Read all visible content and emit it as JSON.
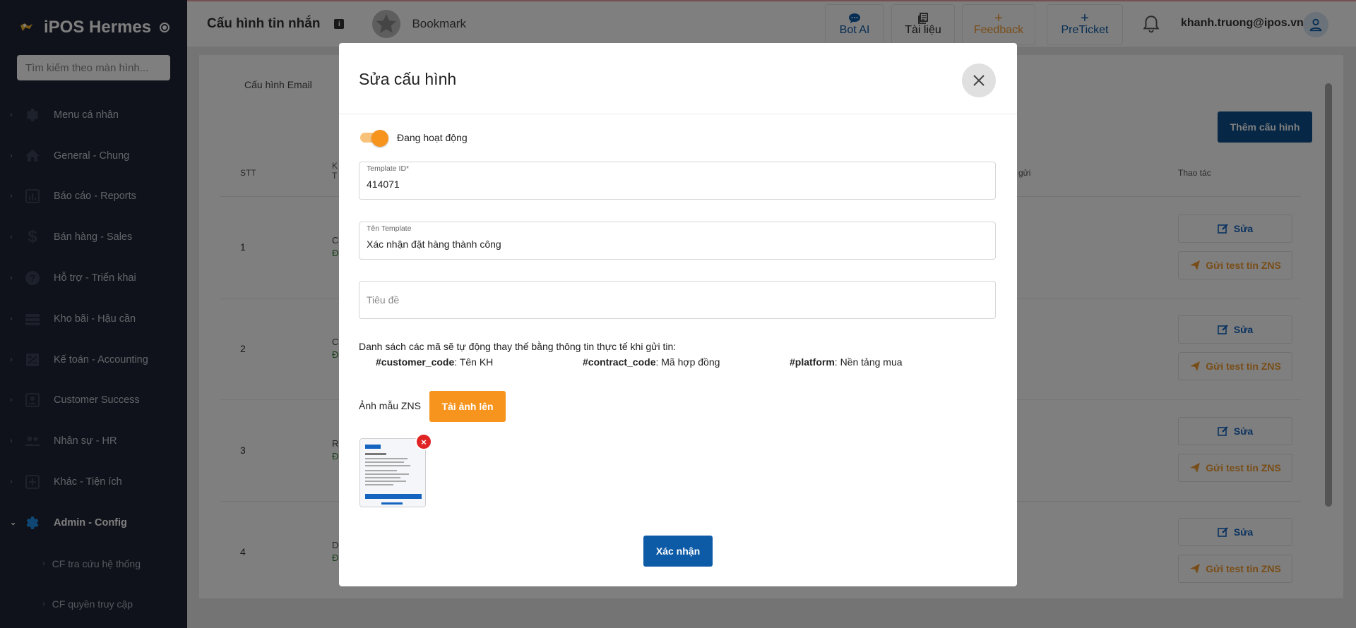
{
  "sidebar": {
    "brand": "iPOS Hermes",
    "search_placeholder": "Tìm kiếm theo màn hình...",
    "items": [
      {
        "label": "Menu cá nhân",
        "icon": "gear-icon"
      },
      {
        "label": "General - Chung",
        "icon": "home-icon"
      },
      {
        "label": "Báo cáo - Reports",
        "icon": "bar-chart-icon"
      },
      {
        "label": "Bán hàng - Sales",
        "icon": "dollar-icon"
      },
      {
        "label": "Hỗ trợ - Triển khai",
        "icon": "help-icon"
      },
      {
        "label": "Kho bãi - Hậu cần",
        "icon": "warehouse-icon"
      },
      {
        "label": "Kế toán - Accounting",
        "icon": "accounting-icon"
      },
      {
        "label": "Customer Success",
        "icon": "contact-card-icon"
      },
      {
        "label": "Nhân sự - HR",
        "icon": "people-icon"
      },
      {
        "label": "Khác - Tiện ích",
        "icon": "add-box-icon"
      },
      {
        "label": "Admin - Config",
        "icon": "gear-icon",
        "active": true
      }
    ],
    "sub_items": [
      {
        "label": "CF tra cứu hệ thống"
      },
      {
        "label": "CF quyền truy cập"
      }
    ]
  },
  "header": {
    "title": "Cấu hình tin nhắn",
    "bookmark_label": "Bookmark",
    "buttons": [
      {
        "label": "Bot AI",
        "icon": "chat-bubble-icon"
      },
      {
        "label": "Tài liệu",
        "icon": "document-icon"
      },
      {
        "label": "Feedback",
        "icon": "plus-icon"
      },
      {
        "label": "PreTicket",
        "icon": "plus-icon"
      }
    ],
    "user_email": "khanh.truong@ipos.vn"
  },
  "background_page": {
    "tab_label": "Cấu hình Email",
    "add_button": "Thêm cấu hình",
    "columns": {
      "stt": "STT",
      "sent_fragment": "gửi",
      "actions": "Thao tác"
    },
    "rows": [
      {
        "stt": "1",
        "frag_top": "C",
        "frag_bottom": "Đ"
      },
      {
        "stt": "2",
        "frag_top": "C",
        "frag_bottom": "Đ"
      },
      {
        "stt": "3",
        "frag_top": "R",
        "frag_bottom": "Đ"
      },
      {
        "stt": "4",
        "frag_top": "D",
        "frag_bottom": "Đ"
      }
    ],
    "header_frag_top": "K",
    "header_frag_bottom": "T",
    "edit_label": "Sửa",
    "test_label": "Gửi test tin ZNS"
  },
  "modal": {
    "title": "Sửa cấu hình",
    "toggle_label": "Đang hoạt động",
    "toggle_on": true,
    "template_id": {
      "label": "Template ID*",
      "value": "414071"
    },
    "template_name": {
      "label": "Tên Template",
      "value": "Xác nhận đặt hàng thành công"
    },
    "subject": {
      "placeholder": "Tiêu đề"
    },
    "codes_intro": "Danh sách các mã sẽ tự động thay thế bằng thông tin thực tế khi gửi tin:",
    "codes": [
      {
        "code": "#customer_code",
        "desc": ": Tên KH"
      },
      {
        "code": "#contract_code",
        "desc": ": Mã hợp đồng"
      },
      {
        "code": "#platform",
        "desc": ": Nền tảng mua"
      }
    ],
    "zns_label": "Ảnh mẫu ZNS",
    "upload_button": "Tải ảnh lên",
    "confirm_button": "Xác nhận"
  },
  "colors": {
    "sidebar_bg": "#1e2535",
    "primary": "#0d4f8b",
    "accent_orange": "#f7941d",
    "link_blue": "#1565c0"
  }
}
